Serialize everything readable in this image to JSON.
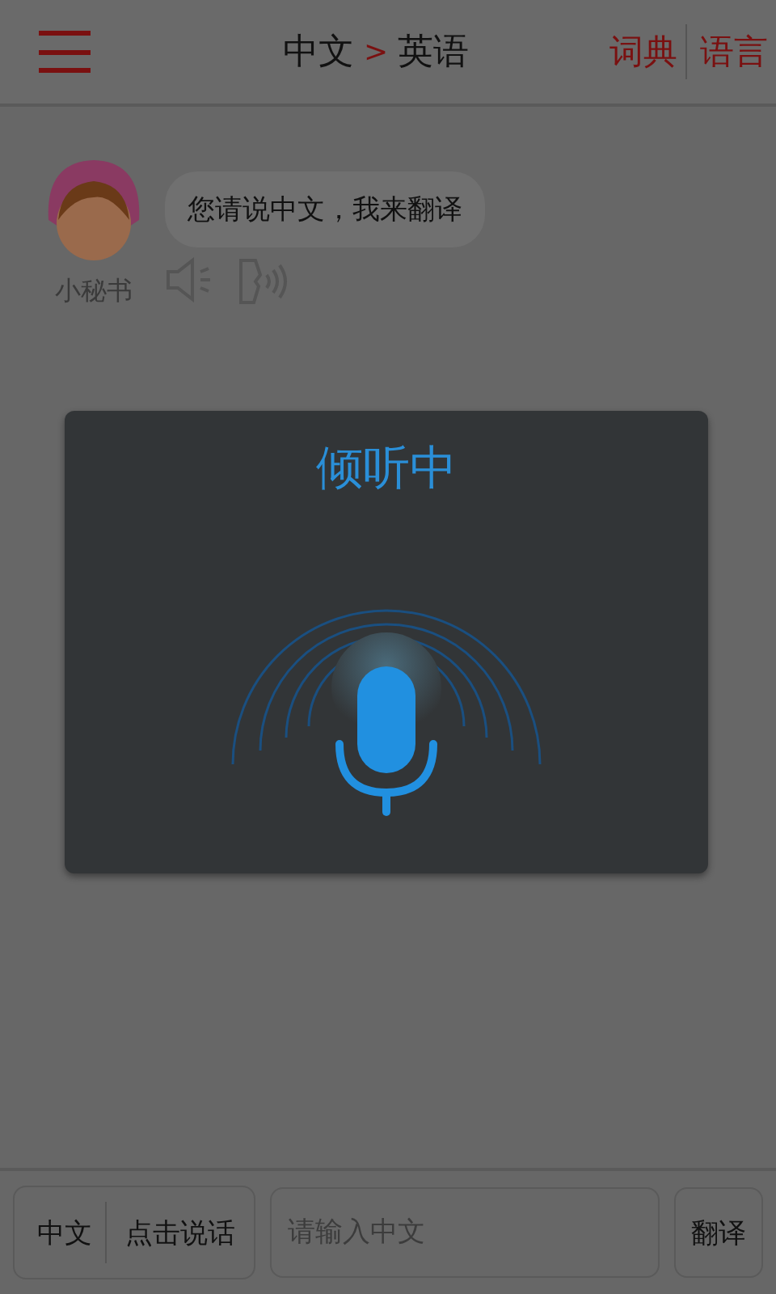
{
  "header": {
    "source": "中文",
    "arrow": ">",
    "target": "英语",
    "actions": [
      "词典",
      "语言"
    ]
  },
  "messages": [
    {
      "sender": "小秘书",
      "text": "您请说中文，我来翻译"
    }
  ],
  "dialog": {
    "title": "倾听中"
  },
  "bottom": {
    "language": "中文",
    "talk": "点击说话",
    "input": {
      "placeholder": "请输入中文"
    },
    "translate": "翻译"
  }
}
